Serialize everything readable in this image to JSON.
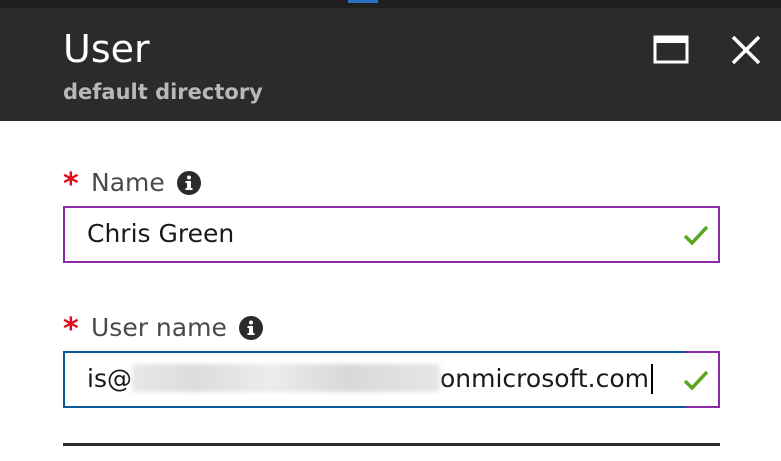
{
  "header": {
    "title": "User",
    "subtitle": "default directory"
  },
  "form": {
    "name_field": {
      "required_marker": "*",
      "label": "Name",
      "value": "Chris Green",
      "valid": true
    },
    "username_field": {
      "required_marker": "*",
      "label": "User name",
      "value_prefix": "is@",
      "value_suffix": "onmicrosoft.com",
      "valid": true
    }
  },
  "colors": {
    "header_bg": "#2b2b2b",
    "required": "#e00b1c",
    "valid_check": "#5aa61f",
    "input_border": "#8a2ba8",
    "focus_border": "#0b5a96"
  },
  "icons": {
    "maximize": "maximize-icon",
    "close": "close-icon",
    "info": "info-icon",
    "check": "checkmark-icon"
  }
}
